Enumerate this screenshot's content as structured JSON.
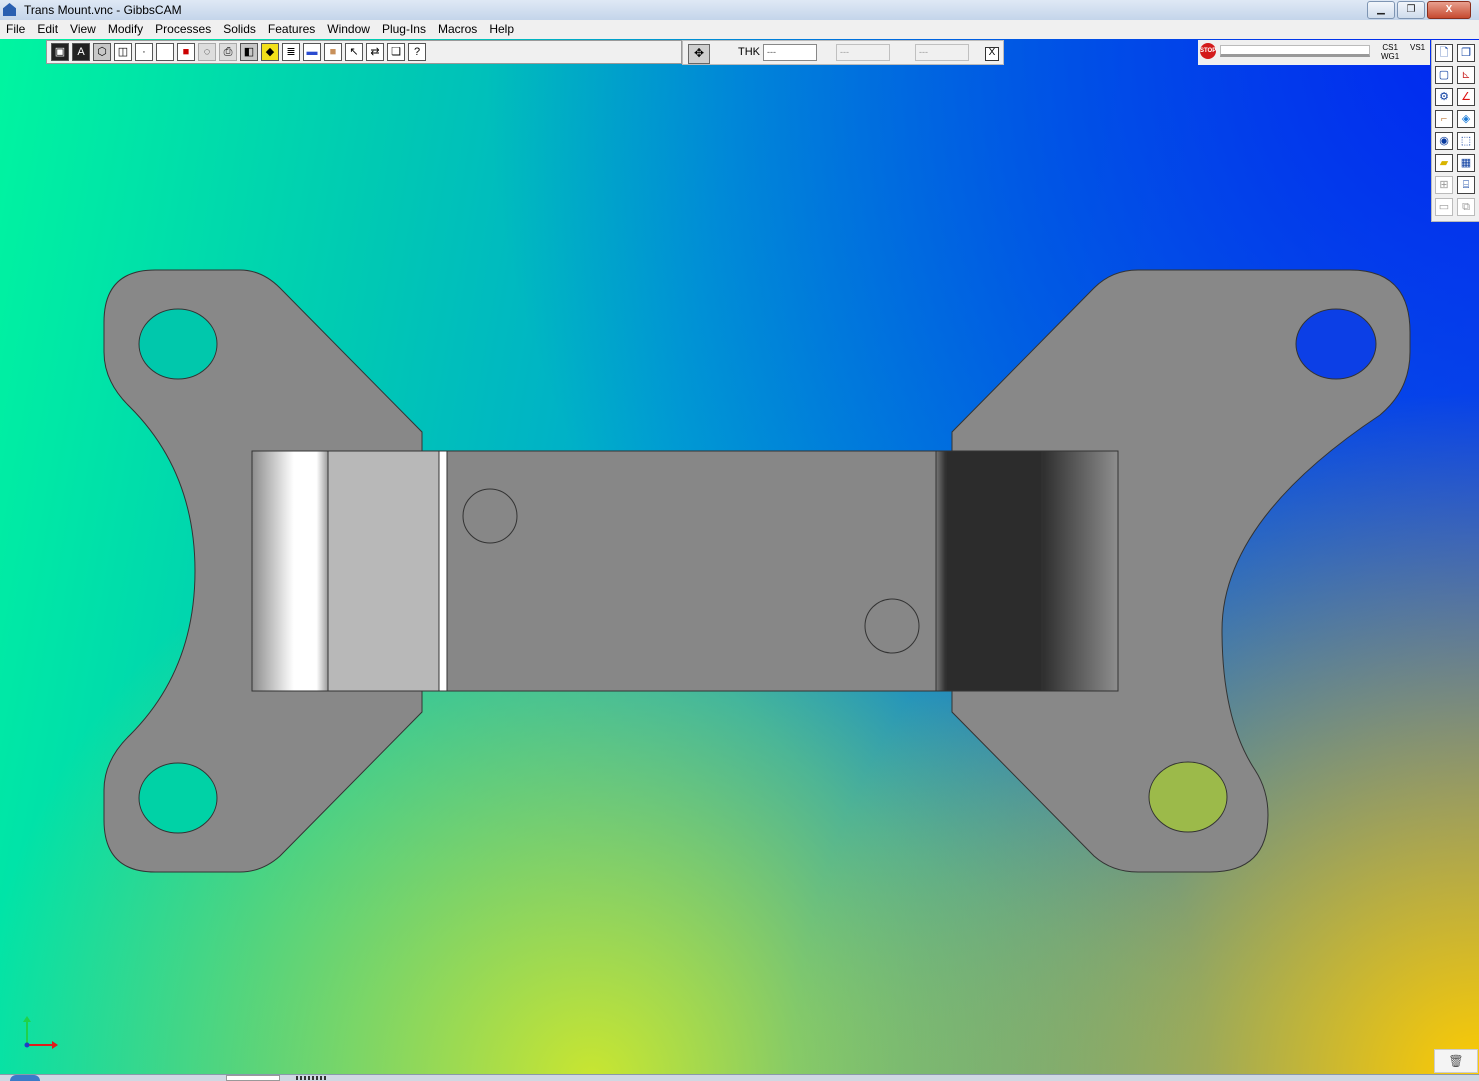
{
  "window": {
    "title": "Trans Mount.vnc - GibbsCAM",
    "buttons": {
      "minimize": "▁",
      "restore": "❐",
      "close": "X"
    }
  },
  "menu": [
    "File",
    "Edit",
    "View",
    "Modify",
    "Processes",
    "Solids",
    "Features",
    "Window",
    "Plug-Ins",
    "Macros",
    "Help"
  ],
  "toolbar": {
    "icons": [
      "view-shaded-icon",
      "view-wireframe-a-icon",
      "view-solid-icon",
      "view-cube-icon",
      "view-cube-outline-icon",
      "point-icon",
      "square-icon",
      "color-icon",
      "mask-icon",
      "print-icon",
      "solid-select-icon",
      "yellow-cube-icon",
      "stack-icon",
      "pipe-icon",
      "block-icon",
      "arrow-cursor-icon",
      "flip-icon",
      "layers-icon",
      "help-pointer-icon"
    ]
  },
  "thk_bar": {
    "label": "THK",
    "thk_value": "---",
    "field2": "---",
    "field3": "---",
    "close": "X"
  },
  "status": {
    "stop_label": "STOP",
    "cs_label": "CS1",
    "wg_label": "WG1",
    "vs_label": "VS1"
  },
  "palette": {
    "icons": [
      "new-file-icon",
      "copy-window-icon",
      "rectangle-select-icon",
      "axis-icon",
      "tool-icon",
      "red-axis-icon",
      "bend-icon",
      "plane-icon",
      "view-eye-icon",
      "box-icon",
      "stock-icon",
      "render-icon",
      "grid-icon",
      "frame-icon",
      "ruler-icon",
      "multi-copy-icon"
    ]
  },
  "colors": {
    "part_gray": "#888888",
    "part_outline": "#333333",
    "dark_face": "#2c2c2c",
    "light_face": "#b8b8b8",
    "axis_red": "#e11a1a",
    "axis_green": "#1fd24a",
    "axis_blue": "#1e3cc8"
  }
}
